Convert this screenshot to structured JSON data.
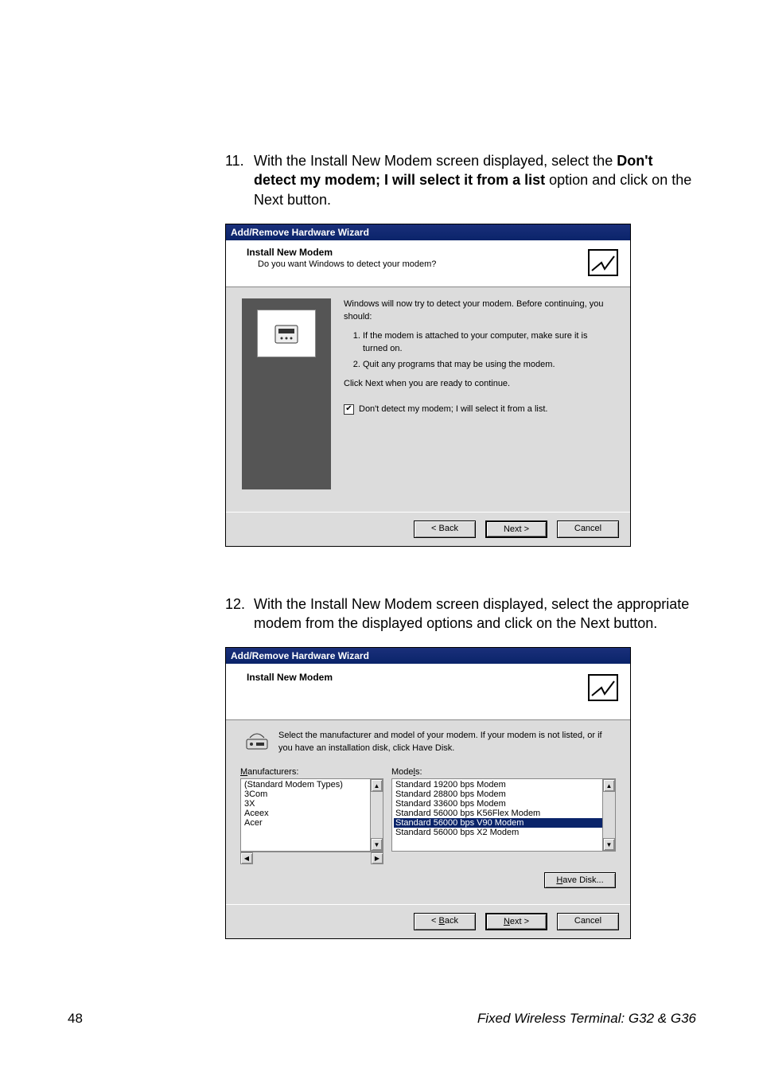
{
  "step11": {
    "number": "11.",
    "pre": "With the Install New Modem screen displayed, select the ",
    "bold": "Don't detect my modem; I will select it from a list",
    "post": " option and click on the Next button."
  },
  "step12": {
    "number": "12.",
    "text": "With the Install New Modem screen displayed, select the appropriate modem from the displayed options and click on the Next button."
  },
  "dialog1": {
    "titlebar": "Add/Remove Hardware Wizard",
    "headerTitle": "Install New Modem",
    "headerSub": "Do you want Windows to detect your modem?",
    "intro": "Windows will now try to detect your modem.  Before continuing, you should:",
    "li1": "If the modem is attached to your computer, make sure it is turned on.",
    "li2": "Quit any programs that may be using the modem.",
    "ready": "Click Next when you are ready to continue.",
    "checkboxChecked": "✔",
    "checkboxLabel": "Don't detect my modem; I will select it from a list.",
    "back": "< Back",
    "next": "Next >",
    "cancel": "Cancel"
  },
  "dialog2": {
    "titlebar": "Add/Remove Hardware Wizard",
    "headerTitle": "Install New Modem",
    "infoText": "Select the manufacturer and model of your modem. If your modem is not listed, or if you have an installation disk, click Have Disk.",
    "manufacturersLabel": "Manufacturers:",
    "modelsLabel": "Models:",
    "manufacturers": [
      "(Standard Modem Types)",
      "3Com",
      "3X",
      "Aceex",
      "Acer"
    ],
    "models": [
      {
        "t": "Standard 19200 bps Modem",
        "sel": false
      },
      {
        "t": "Standard 28800 bps Modem",
        "sel": false
      },
      {
        "t": "Standard 33600 bps Modem",
        "sel": false
      },
      {
        "t": "Standard 56000 bps K56Flex Modem",
        "sel": false
      },
      {
        "t": "Standard 56000 bps V90 Modem",
        "sel": true
      },
      {
        "t": "Standard 56000 bps X2 Modem",
        "sel": false
      }
    ],
    "haveDisk": "Have Disk...",
    "back": "< Back",
    "next": "Next >",
    "cancel": "Cancel"
  },
  "footer": {
    "pageNum": "48",
    "title": "Fixed Wireless Terminal: G32 & G36"
  }
}
